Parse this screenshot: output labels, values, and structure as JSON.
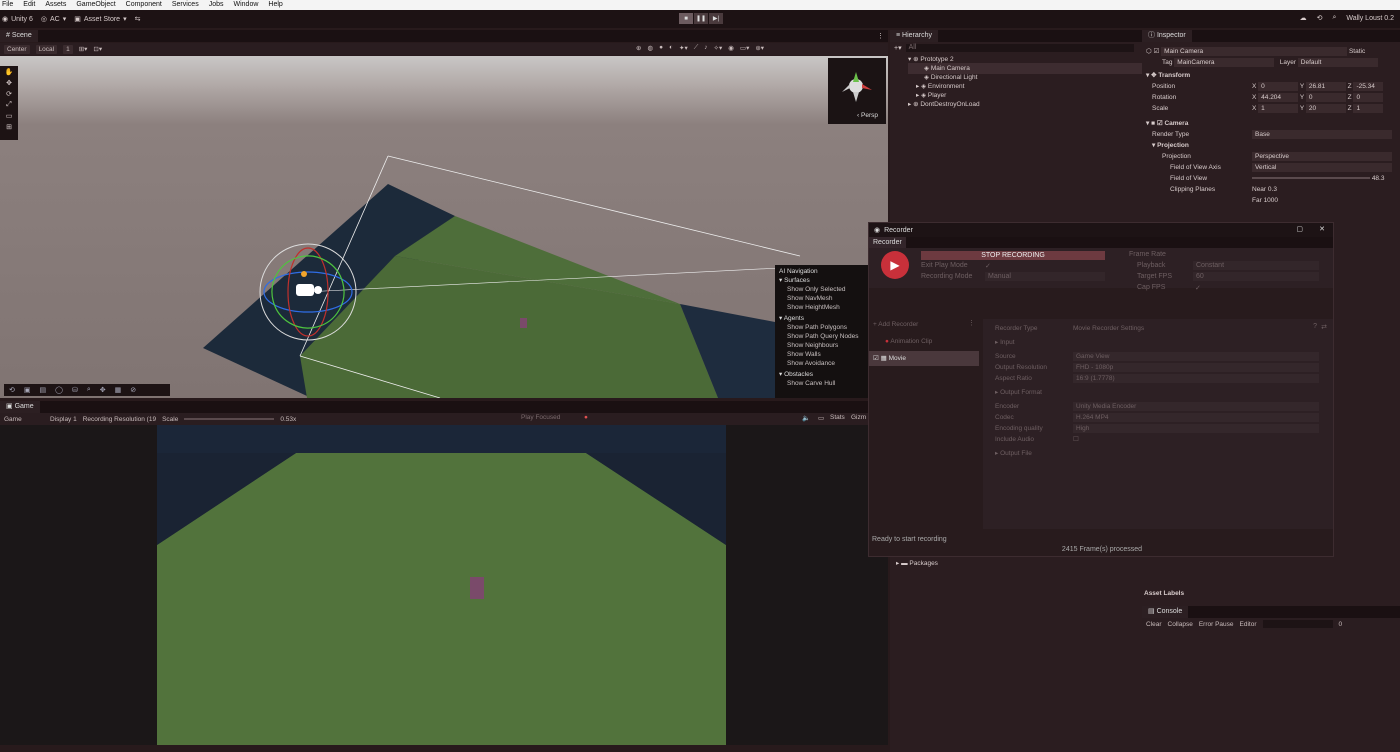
{
  "menu": {
    "items": [
      "File",
      "Edit",
      "Assets",
      "GameObject",
      "Component",
      "Services",
      "Jobs",
      "Window",
      "Help"
    ]
  },
  "toolbar": {
    "unity_label": "Unity 6",
    "ac_label": "AC",
    "asset_store_label": "Asset Store",
    "account_label": "Wally Loust 0.2"
  },
  "scene": {
    "tab_label": "Scene",
    "pivot_label": "Center",
    "space_label": "Local",
    "grid_value": "1",
    "persp_label": "‹ Persp",
    "nav_panel": {
      "title": "AI Navigation",
      "sections": [
        {
          "name": "Surfaces",
          "items": [
            "Show Only Selected",
            "Show NavMesh",
            "Show HeightMesh"
          ]
        },
        {
          "name": "Agents",
          "items": [
            "Show Path Polygons",
            "Show Path Query Nodes",
            "Show Neighbours",
            "Show Walls",
            "Show Avoidance"
          ]
        },
        {
          "name": "Obstacles",
          "items": [
            "Show Carve Hull"
          ]
        }
      ]
    }
  },
  "game": {
    "tab_label": "Game",
    "view_label": "Game",
    "display_label": "Display 1",
    "resolution_label": "Recording Resolution (19",
    "scale_label": "Scale",
    "scale_value": "0.53x",
    "play_focused_label": "Play Focused",
    "stats_label": "Stats",
    "gizmos_label": "Gizm"
  },
  "hierarchy": {
    "tab_label": "Hierarchy",
    "search_placeholder": "All",
    "items": [
      "Prototype 2",
      "Main Camera",
      "Directional Light",
      "Environment",
      "Player",
      "DontDestroyOnLoad"
    ],
    "packages_label": "Packages"
  },
  "inspector": {
    "tab_label": "Inspector",
    "object_name": "Main Camera",
    "static_label": "Static",
    "tag_label": "Tag",
    "tag_value": "MainCamera",
    "layer_label": "Layer",
    "layer_value": "Default",
    "transform": {
      "title": "Transform",
      "position": {
        "label": "Position",
        "x": "0",
        "y": "26.81",
        "z": "-25.34"
      },
      "rotation": {
        "label": "Rotation",
        "x": "44.204",
        "y": "0",
        "z": "0"
      },
      "scale": {
        "label": "Scale",
        "x": "1",
        "y": "20",
        "z": "1"
      }
    },
    "camera": {
      "title": "Camera",
      "render_type_label": "Render Type",
      "render_type_value": "Base",
      "projection_section": "Projection",
      "projection_label": "Projection",
      "projection_value": "Perspective",
      "fov_axis_label": "Field of View Axis",
      "fov_axis_value": "Vertical",
      "fov_label": "Field of View",
      "fov_value": "48.3",
      "clipping_label": "Clipping Planes",
      "near_label": "Near",
      "near_value": "0.3",
      "far_label": "Far",
      "far_value": "1000"
    },
    "asset_labels": "Asset Labels"
  },
  "recorder": {
    "title": "Recorder",
    "tab_label": "Recorder",
    "stop_label": "STOP RECORDING",
    "exit_play_label": "Exit Play Mode",
    "recording_mode_label": "Recording Mode",
    "recording_mode_value": "Manual",
    "frame_rate_label": "Frame Rate",
    "playback_label": "Playback",
    "playback_value": "Constant",
    "target_fps_label": "Target FPS",
    "target_fps_value": "60",
    "cap_fps_label": "Cap FPS",
    "add_recorder_label": "+ Add Recorder",
    "recorders": [
      "Animation Clip",
      "Movie"
    ],
    "recorder_type_label": "Recorder Type",
    "recorder_type_value": "Movie Recorder Settings",
    "input_section": "Input",
    "source_label": "Source",
    "source_value": "Game View",
    "output_res_label": "Output Resolution",
    "output_res_value": "FHD - 1080p",
    "aspect_label": "Aspect Ratio",
    "aspect_value": "16:9 (1.7778)",
    "output_format_section": "Output Format",
    "encoder_label": "Encoder",
    "encoder_value": "Unity Media Encoder",
    "codec_label": "Codec",
    "codec_value": "H.264 MP4",
    "quality_label": "Encoding quality",
    "quality_value": "High",
    "audio_label": "Include Audio",
    "output_file_section": "Output File",
    "status": "Ready to start recording",
    "frames": "2415 Frame(s) processed"
  },
  "console": {
    "tab_label": "Console",
    "clear_label": "Clear",
    "collapse_label": "Collapse",
    "error_pause_label": "Error Pause",
    "editor_label": "Editor",
    "count_label": "0"
  },
  "colors": {
    "bg": "#2b1d20",
    "accent": "#c8303a"
  }
}
